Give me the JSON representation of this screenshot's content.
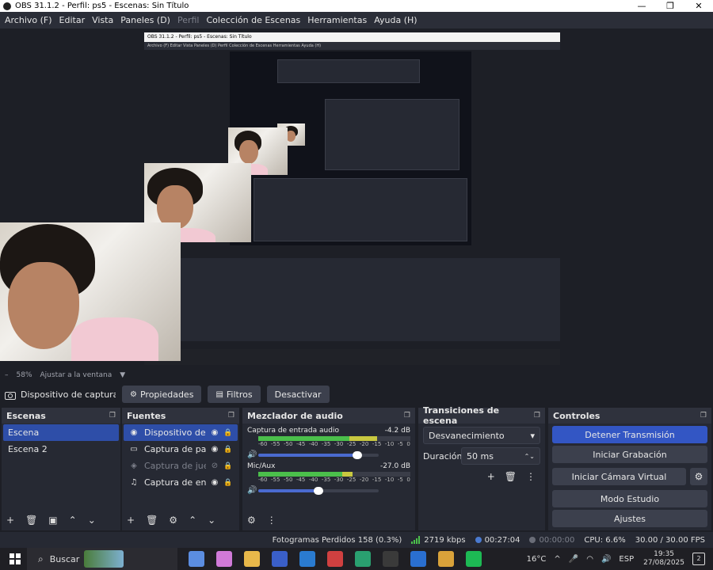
{
  "window": {
    "title": "OBS 31.1.2 - Perfil: ps5 - Escenas: Sin Título",
    "controls": [
      "—",
      "❐",
      "✕"
    ]
  },
  "menu": {
    "items": [
      {
        "label": "Archivo (F)",
        "enabled": true
      },
      {
        "label": "Editar",
        "enabled": true
      },
      {
        "label": "Vista",
        "enabled": true
      },
      {
        "label": "Paneles (D)",
        "enabled": true
      },
      {
        "label": "Perfil",
        "enabled": false
      },
      {
        "label": "Colección de Escenas",
        "enabled": true
      },
      {
        "label": "Herramientas",
        "enabled": true
      },
      {
        "label": "Ayuda (H)",
        "enabled": true
      }
    ]
  },
  "zoom": {
    "minus": "–",
    "percent": "58%",
    "fit_label": "Ajustar a la ventana",
    "arrow": "▼"
  },
  "source_toolbar": {
    "source_name": "Dispositivo de captura de v",
    "properties_label": "Propiedades",
    "filters_label": "Filtros",
    "deactivate_label": "Desactivar"
  },
  "scenes": {
    "title": "Escenas",
    "items": [
      "Escena",
      "Escena 2"
    ],
    "selected": 0
  },
  "sources": {
    "title": "Fuentes",
    "items": [
      {
        "label": "Dispositivo de captu",
        "icon": "camera-icon",
        "visible": true,
        "selected": true
      },
      {
        "label": "Captura de pantalla",
        "icon": "monitor-icon",
        "visible": true,
        "selected": false
      },
      {
        "label": "Captura de juego",
        "icon": "gamepad-icon",
        "visible": false,
        "selected": false
      },
      {
        "label": "Captura de entrada",
        "icon": "microphone-icon",
        "visible": true,
        "selected": false
      }
    ]
  },
  "mixer": {
    "title": "Mezclador de audio",
    "ticks": [
      "-60",
      "-55",
      "-50",
      "-45",
      "-40",
      "-35",
      "-30",
      "-25",
      "-20",
      "-15",
      "-10",
      "-5",
      "0"
    ],
    "channels": [
      {
        "name": "Captura de entrada audio",
        "db": "-4.2 dB",
        "level": 0.78,
        "volume": 0.82
      },
      {
        "name": "Mic/Aux",
        "db": "-27.0 dB",
        "level": 0.62,
        "volume": 0.5
      }
    ]
  },
  "transitions": {
    "title": "Transiciones de escena",
    "selected": "Desvanecimiento",
    "duration_label": "Duración",
    "duration_value": "50 ms"
  },
  "controls": {
    "title": "Controles",
    "stop_streaming": "Detener Transmisión",
    "start_recording": "Iniciar Grabación",
    "start_virtual_cam": "Iniciar Cámara Virtual",
    "studio_mode": "Modo Estudio",
    "settings": "Ajustes"
  },
  "status": {
    "dropped_frames": "Fotogramas Perdidos 158 (0.3%)",
    "bitrate": "2719 kbps",
    "stream_time": "00:27:04",
    "rec_time": "00:00:00",
    "cpu": "CPU: 6.6%",
    "fps": "30.00 / 30.00 FPS"
  },
  "nested": {
    "title": "OBS 31.1.2 - Perfil: ps5 - Escenas: Sin Título",
    "menu": "Archivo (F)   Editar   Vista   Paneles (D)   Perfil   Colección de Escenas   Herramientas   Ayuda (H)"
  },
  "taskbar": {
    "search_placeholder": "Buscar",
    "temperature": "16°C",
    "language": "ESP",
    "time": "19:35",
    "date": "27/08/2025",
    "notifications": "2",
    "chevron": "^",
    "app_colors": [
      "#5b8de0",
      "#d07ad8",
      "#e8b84a",
      "#3a5fc8",
      "#2a7bd0",
      "#d04040",
      "#2aa070",
      "#3a3a3a",
      "#2a6fd0",
      "#d9a23a",
      "#1db954"
    ]
  }
}
